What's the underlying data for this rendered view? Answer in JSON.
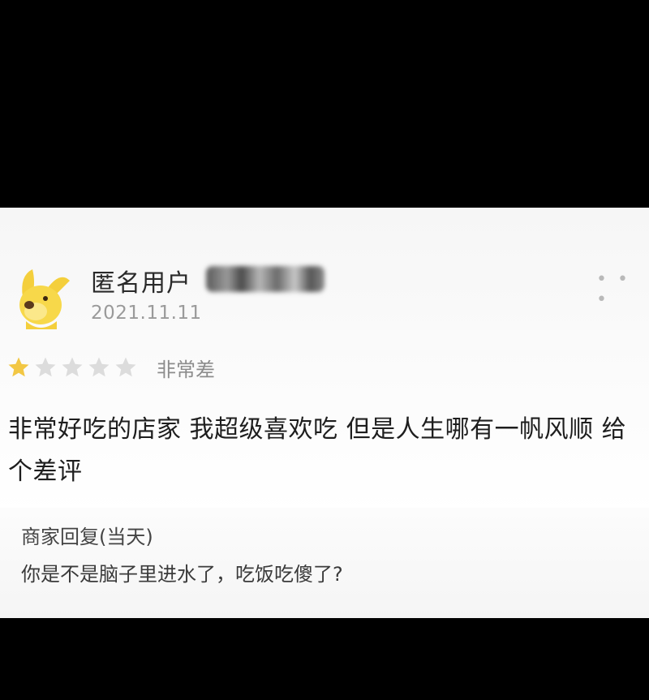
{
  "review": {
    "username": "匿名用户",
    "date": "2021.11.11",
    "more_label": "• • •",
    "rating": {
      "stars_filled": 1,
      "stars_total": 5,
      "label": "非常差"
    },
    "text": "非常好吃的店家 我超级喜欢吃 但是人生哪有一帆风顺 给个差评",
    "avatar_icon": "yellow-dog-icon"
  },
  "reply": {
    "title": "商家回复(当天)",
    "content": "你是不是脑子里进水了，吃饭吃傻了?"
  },
  "colors": {
    "star_filled": "#f2c744",
    "star_empty": "#dcdcdc",
    "background": "#000000",
    "card": "#fafafa"
  }
}
